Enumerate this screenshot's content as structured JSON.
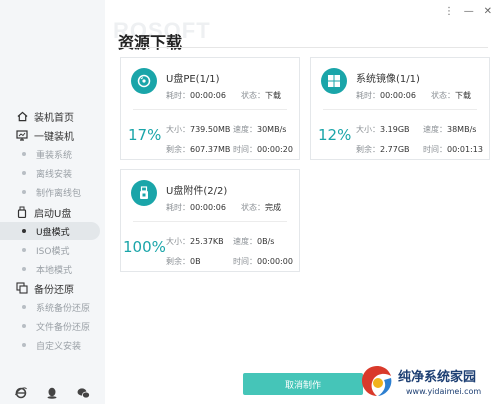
{
  "window": {
    "controls": [
      "⋮",
      "—",
      "✕"
    ]
  },
  "watermark": "ROSOFT",
  "title": "资源下载",
  "sidebar": {
    "groups": [
      {
        "label": "装机首页",
        "icon": "home-icon",
        "items": []
      },
      {
        "label": "一键装机",
        "icon": "monitor-icon",
        "items": [
          "重装系统",
          "离线安装",
          "制作离线包"
        ]
      },
      {
        "label": "启动U盘",
        "icon": "usb-icon",
        "items": [
          "U盘模式",
          "ISO模式",
          "本地模式"
        ]
      },
      {
        "label": "备份还原",
        "icon": "backup-icon",
        "items": [
          "系统备份还原",
          "文件备份还原",
          "自定义安装"
        ]
      }
    ],
    "active_item": "U盘模式",
    "bottom_icons": [
      "ie-icon",
      "qq-icon",
      "wechat-icon"
    ]
  },
  "downloads": [
    {
      "name": "U盘PE(1/1)",
      "icon": "disc-icon",
      "elapsed_label": "耗时：",
      "elapsed": "00:00:06",
      "status_label": "状态：",
      "status": "下载",
      "percent": "17%",
      "size_label": "大小：",
      "size": "739.50MB",
      "speed_label": "速度：",
      "speed": "30MB/s",
      "remain_label": "剩余：",
      "remain": "607.37MB",
      "time_label": "时间：",
      "time": "00:00:20"
    },
    {
      "name": "系统镜像(1/1)",
      "icon": "windows-icon",
      "elapsed_label": "耗时：",
      "elapsed": "00:00:06",
      "status_label": "状态：",
      "status": "下载",
      "percent": "12%",
      "size_label": "大小：",
      "size": "3.19GB",
      "speed_label": "速度：",
      "speed": "38MB/s",
      "remain_label": "剩余：",
      "remain": "2.77GB",
      "time_label": "时间：",
      "time": "00:01:13"
    },
    {
      "name": "U盘附件(2/2)",
      "icon": "usb-drive-icon",
      "elapsed_label": "耗时：",
      "elapsed": "00:00:06",
      "status_label": "状态：",
      "status": "完成",
      "percent": "100%",
      "size_label": "大小：",
      "size": "25.37KB",
      "speed_label": "速度：",
      "speed": "0B/s",
      "remain_label": "剩余：",
      "remain": "0B",
      "time_label": "时间：",
      "time": "00:00:00"
    }
  ],
  "cancel_button": "取消制作",
  "brand": {
    "name": "纯净系统家园",
    "url": "www.yidaimei.com"
  },
  "colors": {
    "accent": "#1aa5a9",
    "button": "#45c5b8",
    "brand": "#1d3f73"
  }
}
